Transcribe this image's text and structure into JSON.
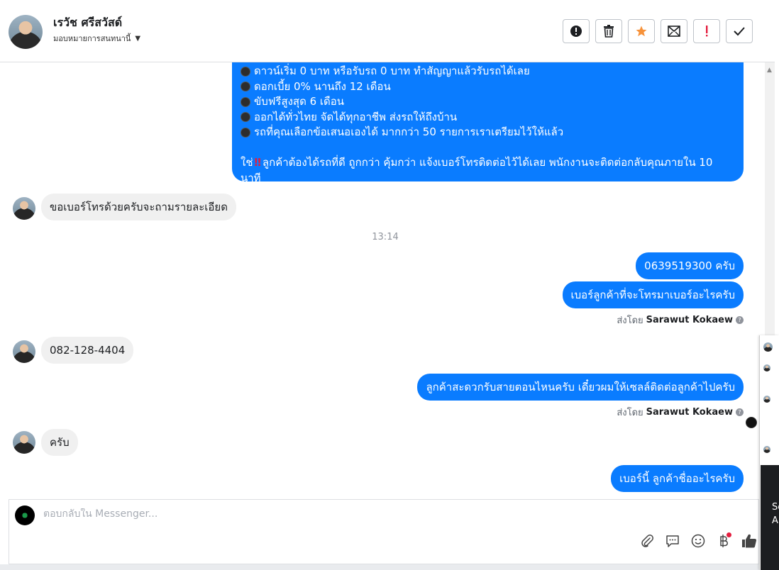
{
  "header": {
    "contact_name": "เรวัช ศรีสวัสด์",
    "assign_label": "มอบหมายการสนทนานี้",
    "actions": [
      {
        "name": "spam-button",
        "icon": "exclamation-circle-icon"
      },
      {
        "name": "delete-button",
        "icon": "trash-icon"
      },
      {
        "name": "star-button",
        "icon": "star-icon"
      },
      {
        "name": "mark-unread-button",
        "icon": "envelope-icon"
      },
      {
        "name": "follow-up-button",
        "icon": "red-exclamation-icon"
      },
      {
        "name": "done-button",
        "icon": "check-icon"
      }
    ]
  },
  "messages": {
    "top_bubble": {
      "line0": "ดาวน์เริ่ม 0 บาท หรือรับรถ 0 บาท ทำสัญญาแล้วรับรถได้เลย",
      "line1": "ดอกเบี้ย 0% นานถึง 12 เดือน",
      "line2": "ขับฟรีสูงสุด 6 เดือน",
      "line3": "ออกได้ทั่วไทย จัดได้ทุกอาชีพ ส่งรถให้ถึงบ้าน",
      "line4": "รถที่คุณเลือกข้อเสนอเองได้ มากกว่า 50 รายการเราเตรียมไว้ให้แล้ว",
      "line5a": "ใช่",
      "line5b": "ลูกค้าต้องได้รถที่ดี ถูกกว่า คุ้มกว่า แจ้งเบอร์โทรติดต่อไว้ได้เลย พนักงานจะติดต่อกลับคุณภายใน 10",
      "line6": "นาที"
    },
    "in_1": "ขอเบอร์โทรด้วยครับจะถามรายละเอียด",
    "time_sep": "13:14",
    "out_1": "0639519300 ครับ",
    "out_2": "เบอร์ลูกค้าที่จะโทรมาเบอร์อะไรครับ",
    "sent_by_label": "ส่งโดย",
    "sent_by_name": "Sarawut Kokaew",
    "in_2": "082-128-4404",
    "out_3": "ลูกค้าสะดวกรับสายตอนไหนครับ เดี๋ยวผมให้เซลล์ติดต่อลูกค้าไปครับ",
    "in_3": "ครับ",
    "out_4": "เบอร์นี้ ลูกค้าชื่ออะไรครับ"
  },
  "composer": {
    "placeholder": "ตอบกลับใน Messenger..."
  },
  "side_panel": {
    "text_1": "Se",
    "text_2": "A"
  },
  "colors": {
    "outgoing": "#0a7cff",
    "incoming": "#f0f0f0",
    "star": "#f7923a",
    "alert": "#e41e3f"
  }
}
